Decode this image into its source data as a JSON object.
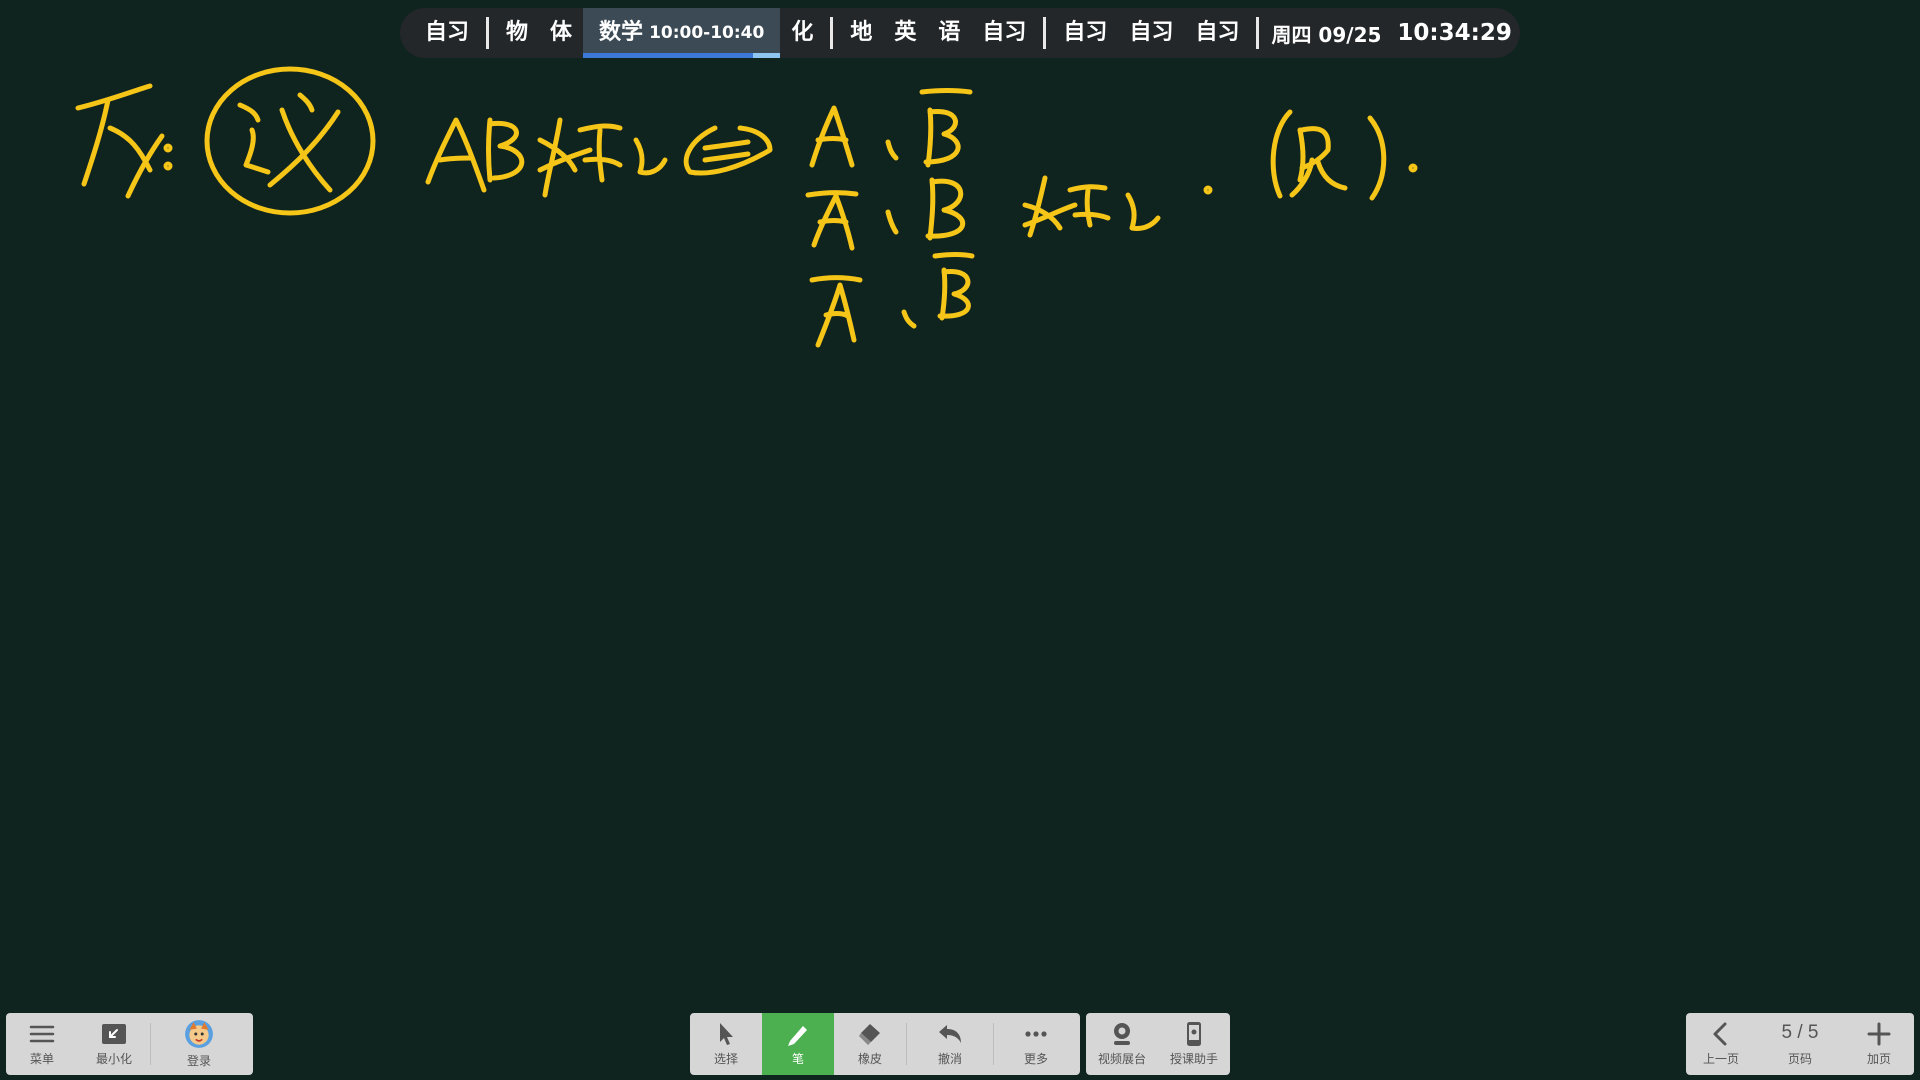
{
  "schedule": {
    "periods_before": [
      "自习",
      "物",
      "体"
    ],
    "current": {
      "subject": "数学",
      "time": "10:00-10:40",
      "progress": 0.86
    },
    "after_current": [
      "化"
    ],
    "group2": [
      "地",
      "英",
      "语",
      "自习"
    ],
    "group3": [
      "自习",
      "自习",
      "自习"
    ],
    "date": "周四 09/25",
    "clock": "10:34:29"
  },
  "colors": {
    "board": "#0f231f",
    "ink": "#f5c518",
    "active_tool": "#4caf50"
  },
  "left_toolbar": {
    "menu": "菜单",
    "minimize": "最小化",
    "login": "登录"
  },
  "center_toolbar": {
    "select": "选择",
    "pen": "笔",
    "eraser": "橡皮",
    "undo": "撤消",
    "more": "更多"
  },
  "side_toolbar": {
    "camera": "视频展台",
    "assistant": "授课助手"
  },
  "page_toolbar": {
    "prev": "上一页",
    "page_indicator": "5 / 5",
    "page_label": "页码",
    "add": "加页"
  },
  "icons": {
    "menu": "hamburger-icon",
    "minimize": "minimize-icon",
    "login": "avatar-icon",
    "select": "cursor-icon",
    "pen": "pen-icon",
    "eraser": "eraser-icon",
    "undo": "undo-icon",
    "more": "more-icon",
    "camera": "webcam-icon",
    "assistant": "phone-icon",
    "prev": "chevron-left-icon",
    "add": "plus-icon"
  }
}
